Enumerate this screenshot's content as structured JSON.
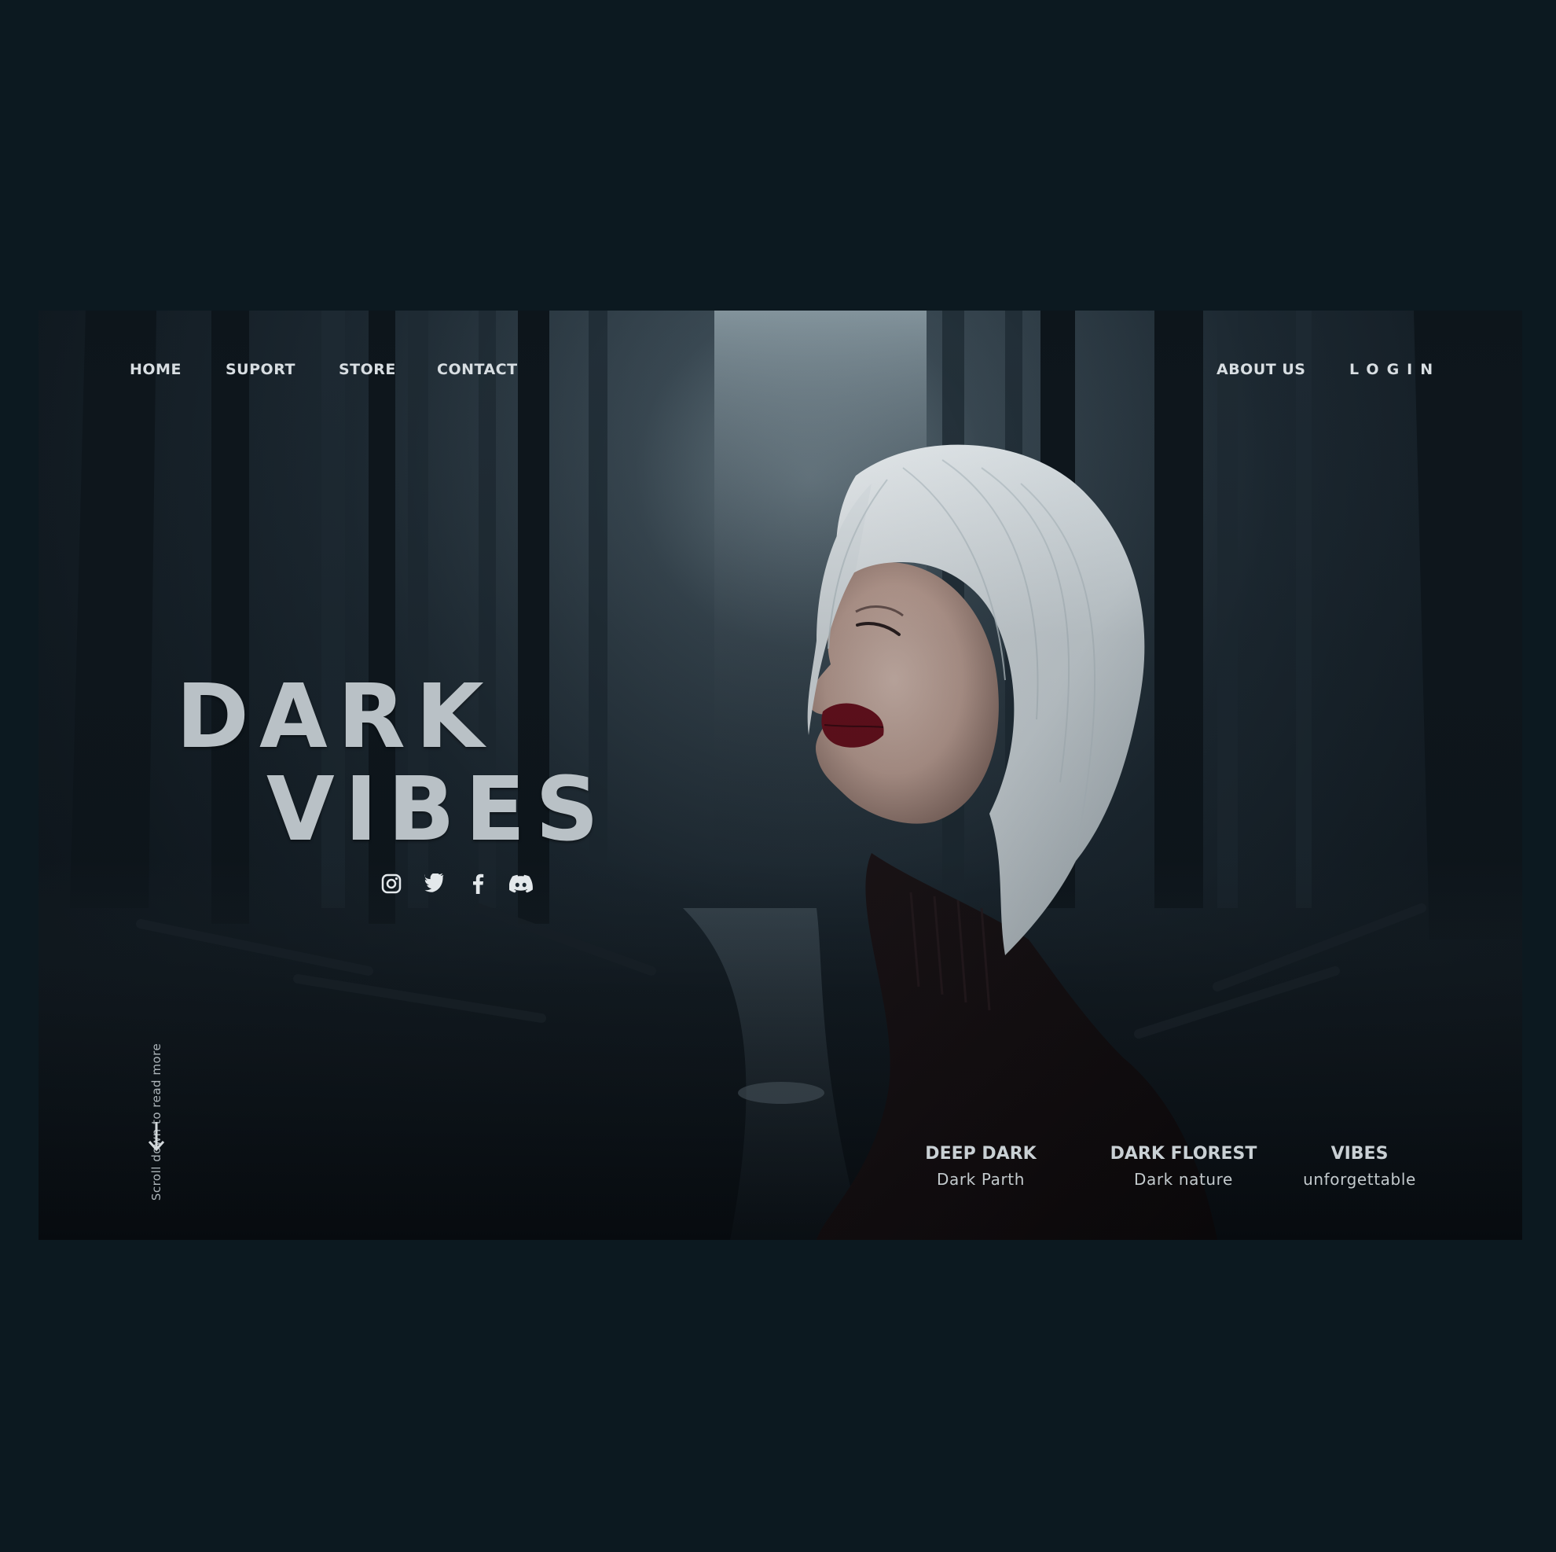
{
  "nav": {
    "left": [
      {
        "label": "HOME"
      },
      {
        "label": "SUPORT"
      },
      {
        "label": "STORE"
      },
      {
        "label": "CONTACT"
      }
    ],
    "right": [
      {
        "label": "ABOUT US"
      },
      {
        "label": "LOGIN"
      }
    ]
  },
  "hero": {
    "title_line1": "DARK",
    "title_line2": "VIBES"
  },
  "social": [
    "instagram-icon",
    "twitter-icon",
    "facebook-icon",
    "discord-icon"
  ],
  "scroll": {
    "text": "Scroll down to read more"
  },
  "features": [
    {
      "title": "DEEP DARK",
      "subtitle": "Dark Parth"
    },
    {
      "title": "DARK FLOREST",
      "subtitle": "Dark nature"
    },
    {
      "title": "VIBES",
      "subtitle": "unforgettable"
    }
  ],
  "colors": {
    "page_background": "#0c1920",
    "text_primary": "#d8dee2",
    "title": "#b9c1c6",
    "lips": "#6e0d1a",
    "hair": "#e6ecef"
  }
}
